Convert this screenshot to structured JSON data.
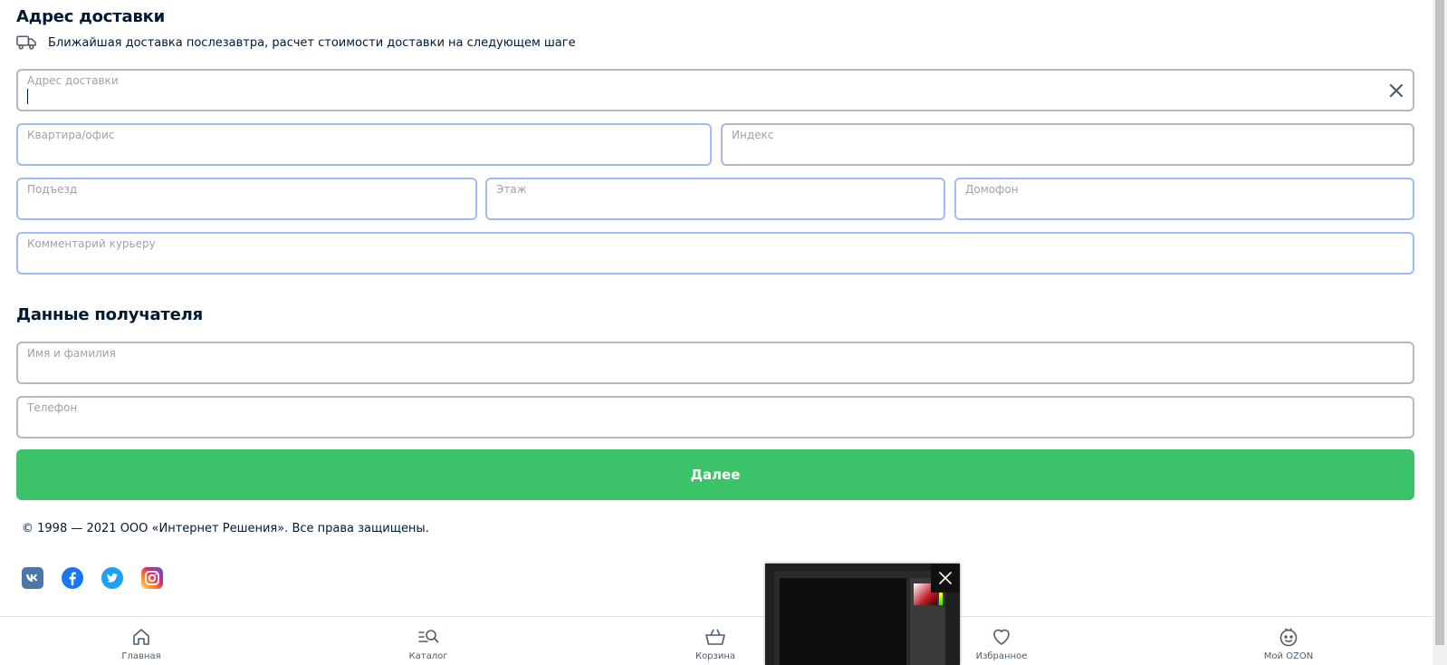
{
  "delivery": {
    "title": "Адрес доставки",
    "hint": "Ближайшая доставка послезавтра, расчет стоимости доставки на следующем шаге",
    "address_label": "Адрес доставки",
    "address_value": "",
    "apartment_label": "Квартира/офис",
    "zip_label": "Индекс",
    "entrance_label": "Подъезд",
    "floor_label": "Этаж",
    "intercom_label": "Домофон",
    "comment_label": "Комментарий курьеру"
  },
  "recipient": {
    "title": "Данные получателя",
    "name_label": "Имя и фамилия",
    "phone_label": "Телефон"
  },
  "actions": {
    "next_label": "Далее"
  },
  "footer": {
    "copyright": "© 1998 — 2021 ООО «Интернет Решения». Все права защищены.",
    "socials": [
      "vk-icon",
      "facebook-icon",
      "twitter-icon",
      "instagram-icon"
    ]
  },
  "nav": {
    "items": [
      {
        "label": "Главная",
        "icon": "home-icon"
      },
      {
        "label": "Каталог",
        "icon": "catalog-icon"
      },
      {
        "label": "Корзина",
        "icon": "cart-icon"
      },
      {
        "label": "Избранное",
        "icon": "heart-icon"
      },
      {
        "label": "Мой OZON",
        "icon": "profile-icon"
      }
    ]
  },
  "colors": {
    "accent_green": "#3cc36a",
    "text_dark": "#001a34",
    "field_border": "#b3b9c0",
    "field_border_focus": "#9ebdf5",
    "vk": "#4a76a8",
    "facebook": "#1877f2",
    "twitter": "#1da1f2"
  }
}
